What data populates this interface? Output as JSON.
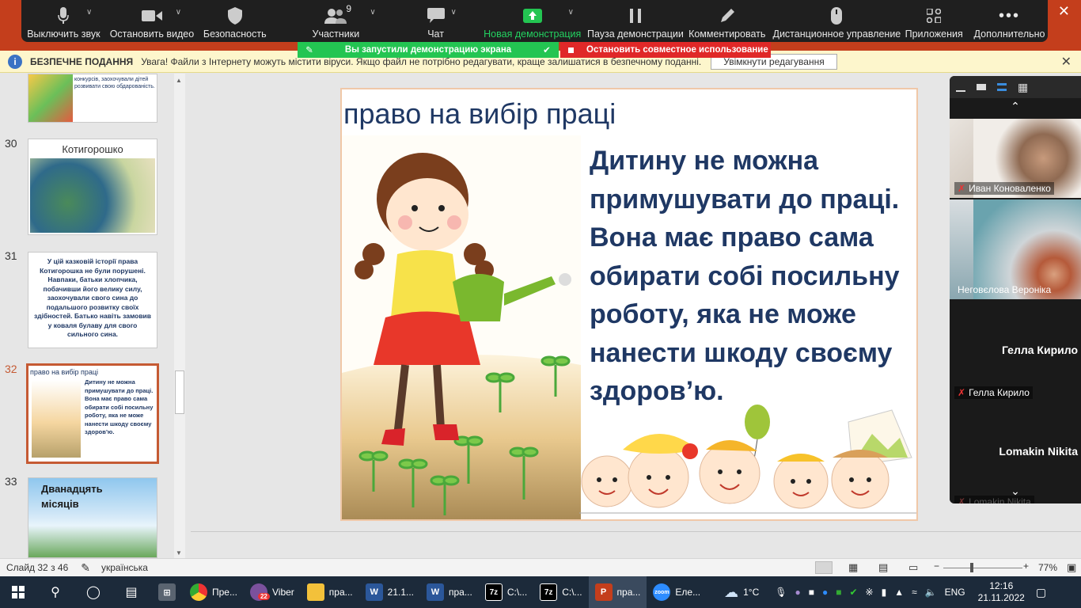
{
  "zoom_toolbar": {
    "mute": "Выключить звук",
    "stop_video": "Остановить видео",
    "security": "Безопасность",
    "participants": "Участники",
    "participants_count": "9",
    "chat": "Чат",
    "new_share": "Новая демонстрация",
    "pause_share": "Пауза демонстрации",
    "annotate": "Комментировать",
    "remote_control": "Дистанционное управление",
    "apps": "Приложения",
    "more": "Дополнительно"
  },
  "share_banner": {
    "sharing_text": "Вы запустили демонстрацию экрана",
    "stop_text": "Остановить совместное использование"
  },
  "protected_view": {
    "title": "БЕЗПЕЧНЕ ПОДАННЯ",
    "message": "Увага! Файли з Інтернету можуть містити віруси. Якщо файл не потрібно редагувати, краще залишатися в безпечному поданні.",
    "enable_button": "Увімкнути редагування"
  },
  "thumbnails": [
    {
      "num": "",
      "caption": "конкурсів, заохочували дітей розвивати свою обдарованість."
    },
    {
      "num": "30",
      "caption": "Котигорошко"
    },
    {
      "num": "31",
      "caption": "У цій казковій історії права Котигорошка не були порушені. Навпаки, батьки хлопчика, побачивши його велику силу, заохочували свого сина до подальшого розвитку своїх здібностей. Батько навіть замовив у коваля булаву для свого сильного сина."
    },
    {
      "num": "32",
      "caption": "право на вибір праці",
      "body": "Дитину не можна примушувати до праці. Вона має право сама обирати собі посильну роботу, яка не може нанести шкоду своєму здоров’ю."
    },
    {
      "num": "33",
      "caption": "Дванадцять місяців"
    }
  ],
  "slide": {
    "title": "право на вибір праці",
    "body": "Дитину не можна примушувати до праці. Вона має право сама обирати собі посильну роботу, яка не може нанести шкоду своєму здоров’ю."
  },
  "video_panel": {
    "p1": "Иван Коноваленко",
    "p2": "Неговєлова Вероніка",
    "p3_big": "Гелла Кирило",
    "p3": "Гелла Кирило",
    "p4_big": "Lomakin Nikita",
    "p4": "Lomakin Nikita"
  },
  "status_bar": {
    "slide_info": "Слайд 32 з 46",
    "language": "українська",
    "zoom": "77%"
  },
  "taskbar": {
    "apps": [
      {
        "label": "Пре..."
      },
      {
        "label": "Viber",
        "badge": "22"
      },
      {
        "label": "пра..."
      },
      {
        "label": "21.1..."
      },
      {
        "label": "пра..."
      },
      {
        "label": "C:\\..."
      },
      {
        "label": "C:\\..."
      },
      {
        "label": "пра..."
      },
      {
        "label": "Еле..."
      }
    ],
    "weather": "1°C",
    "lang": "ENG",
    "time": "12:16",
    "date": "21.11.2022"
  },
  "colors": {
    "accent": "#c43e1c",
    "share_green": "#23c552",
    "share_red": "#e02828",
    "slide_text": "#1f3864"
  }
}
